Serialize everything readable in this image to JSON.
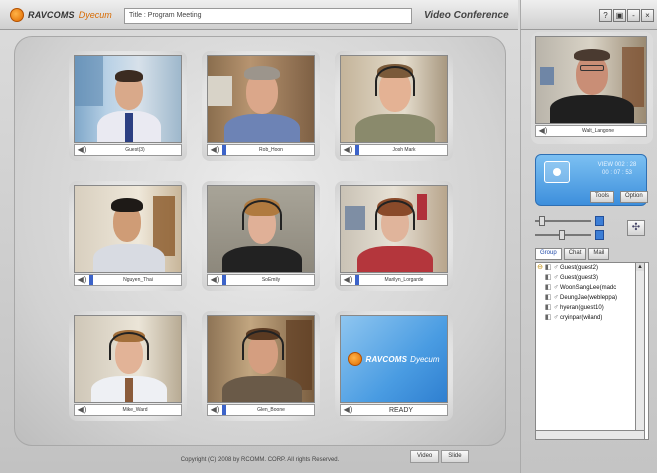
{
  "app": {
    "logo_text": "RAVCOMS",
    "logo_sub": "Dyecum",
    "meeting_field": "Title : Program Meeting",
    "window_title": "Video Conference",
    "window_buttons": [
      "?",
      "▣",
      "-",
      "×"
    ]
  },
  "grid": [
    {
      "name": "Guest(3)",
      "ready": false
    },
    {
      "name": "Rob_Hoon",
      "ready": false
    },
    {
      "name": "Josh Mark",
      "ready": false
    },
    {
      "name": "Nguyen_Thai",
      "ready": false
    },
    {
      "name": "SoEmily",
      "ready": false
    },
    {
      "name": "Marilyn_Lorgarde",
      "ready": false
    },
    {
      "name": "Mike_Ward",
      "ready": false
    },
    {
      "name": "Glen_Boone",
      "ready": false
    },
    {
      "name": "READY",
      "ready": true
    }
  ],
  "ready_logo": {
    "text": "RAVCOMS",
    "sub": "Dyecum"
  },
  "footer": {
    "copyright": "Copyright (C) 2008 by RCOMM. CORP. All rights Reserved.",
    "tab_video": "Video",
    "tab_slide": "Slide"
  },
  "self_view": {
    "name": "Walt_Langone"
  },
  "status": {
    "line1": "VIEW 002 : 28",
    "line2": "00 : 07 : 53",
    "tools_label": "Tools",
    "option_label": "Option"
  },
  "user_tabs": {
    "group": "Group",
    "chat": "Chat",
    "mail": "Mail"
  },
  "users": [
    "Guest(guest2)",
    "Guest(guest3)",
    "WoonSangLee(madc",
    "DeungJae(webleppa)",
    "hyeran(guest10)",
    "cryinpar(wiland)"
  ],
  "icons": {
    "speaker": "speaker-icon",
    "gear": "gear-icon",
    "user": "user-icon"
  },
  "colors": {
    "accent": "#3c63c9",
    "ready_bg": "#4a9ce2",
    "status_bg": "#3d8fdc"
  }
}
